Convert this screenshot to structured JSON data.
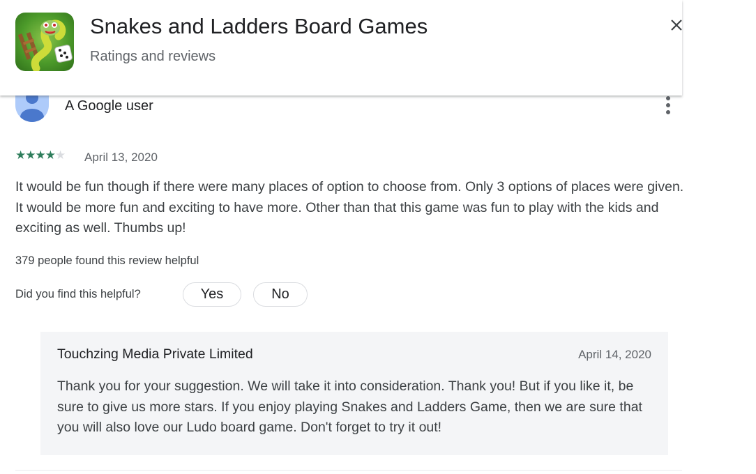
{
  "app": {
    "title": "Snakes and Ladders Board Games",
    "subtitle": "Ratings and reviews",
    "icon": "snake-dice-app-icon"
  },
  "review": {
    "user_name": "A Google user",
    "rating": 4,
    "max_rating": 5,
    "date": "April 13, 2020",
    "text": "It would be fun though if there were many places of option to choose from. Only 3 options of places were given. It would be more fun and exciting to have more. Other than that this game was fun to play with the kids and exciting as well. Thumbs up!",
    "helpful_count": "379 people found this review helpful",
    "helpful_question": "Did you find this helpful?",
    "yes_label": "Yes",
    "no_label": "No"
  },
  "reply": {
    "developer": "Touchzing Media Private Limited",
    "date": "April 14, 2020",
    "text": "Thank you for your suggestion. We will take it into consideration. Thank you! But if you like it, be sure to give us more stars. If you enjoy playing Snakes and Ladders Game, then we are sure that you will also love our Ludo board game. Don't forget to try it out!"
  },
  "colors": {
    "star": "#2e7d5b",
    "star_empty": "#dadce0",
    "reply_bg": "#f4f5f7",
    "avatar": "#aecbfa"
  }
}
